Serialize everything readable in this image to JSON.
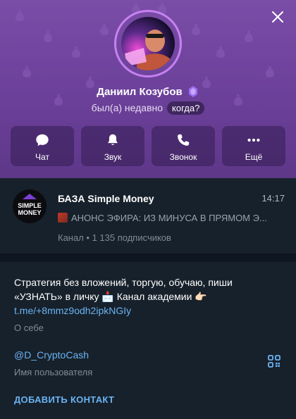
{
  "profile": {
    "name": "Даниил Козубов",
    "status": "был(а) недавно",
    "when_button": "когда?",
    "badge_icon": "premium-star-icon",
    "accent_color": "#c781f2"
  },
  "actions": [
    {
      "label": "Чат",
      "icon": "chat-icon"
    },
    {
      "label": "Звук",
      "icon": "bell-icon"
    },
    {
      "label": "Звонок",
      "icon": "phone-icon"
    },
    {
      "label": "Ещё",
      "icon": "more-icon"
    }
  ],
  "channel": {
    "title": "БАЗА Simple Money",
    "time": "14:17",
    "preview": "АНОНС ЭФИРА: ИЗ МИНУСА В ПРЯМОМ Э...",
    "meta": "Канал • 1 135 подписчиков",
    "avatar_text_1": "SIMPLE",
    "avatar_text_2": "MONEY"
  },
  "about": {
    "bio_line1": "Стратегия без вложений, торгую, обучаю, пиши",
    "bio_line2": "«УЗНАТЬ» в личку 📩 Канал академии 👉🏻",
    "bio_link": "t.me/+8mmz9odh2ipkNGIy",
    "bio_label": "О себе",
    "username": "@D_CryptoCash",
    "username_label": "Имя пользователя",
    "add_contact": "ДОБАВИТЬ КОНТАКТ"
  }
}
